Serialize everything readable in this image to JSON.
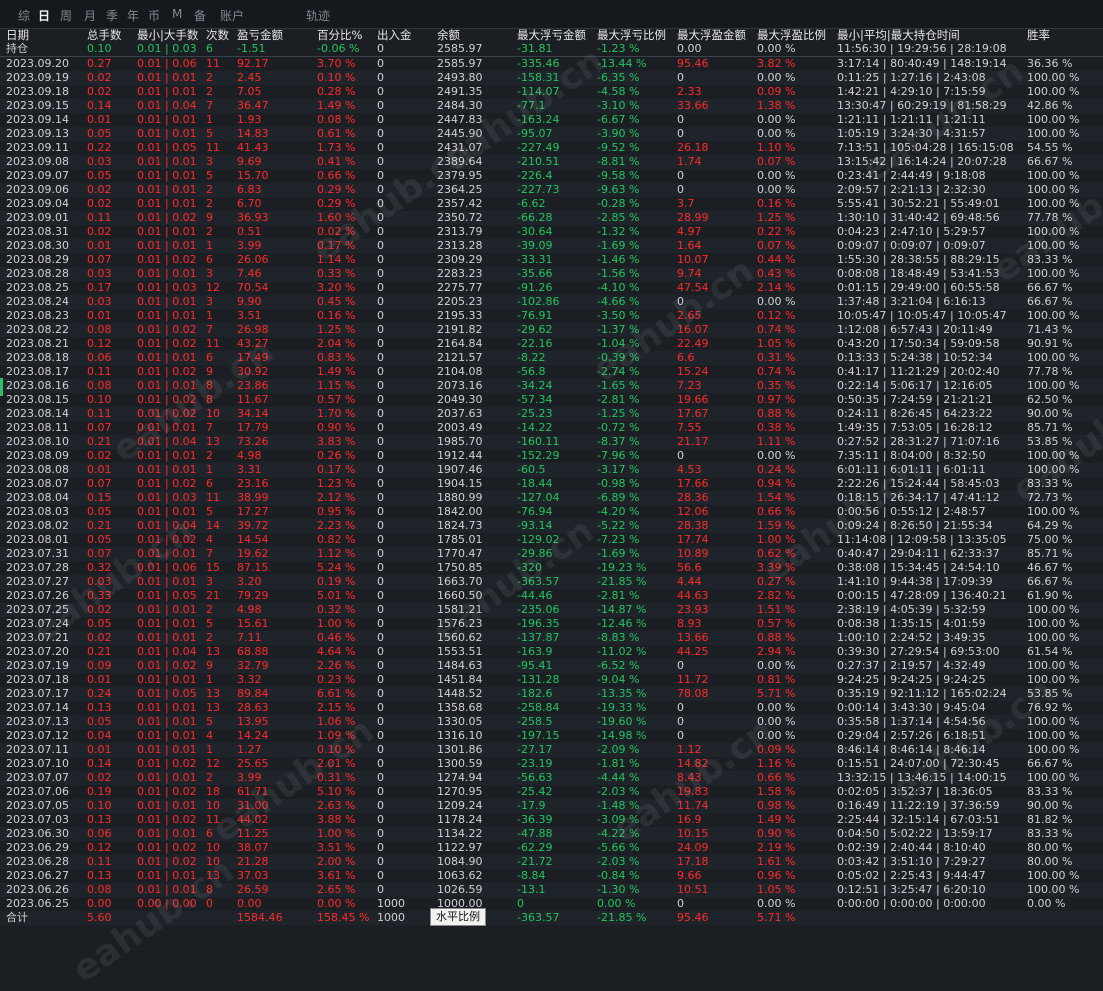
{
  "tabs": [
    {
      "label": "综",
      "active": false
    },
    {
      "label": "日",
      "active": true
    },
    {
      "label": "周",
      "active": false
    },
    {
      "label": "月",
      "active": false
    },
    {
      "label": "季",
      "active": false
    },
    {
      "label": "年",
      "active": false
    },
    {
      "label": "币",
      "active": false
    },
    {
      "label": "M",
      "active": false
    },
    {
      "label": "备",
      "active": false
    },
    {
      "label": "账户",
      "active": false
    },
    {
      "label": "轨迹",
      "active": false
    }
  ],
  "columns": [
    "日期\n持仓",
    "总手数",
    "最小|大手数",
    "次数",
    "盈亏金额",
    "百分比%",
    "出入金",
    "余额",
    "最大浮亏金额",
    "最大浮亏比例",
    "最大浮盈金额",
    "最大浮盈比例",
    "最小|平均|最大持仓时间",
    "胜率"
  ],
  "header_top": [
    "日期",
    "总手数",
    "最小|大手数",
    "次数",
    "盈亏金额",
    "百分比%",
    "出入金",
    "余额",
    "最大浮亏金额",
    "最大浮亏比例",
    "最大浮盈金额",
    "最大浮盈比例",
    "最小|平均|最大持仓时间",
    "胜率"
  ],
  "position_row": [
    "持仓",
    "0.10",
    "0.01 | 0.03",
    "6",
    "-1.51",
    "-0.06 %",
    "0",
    "2585.97",
    "-31.81",
    "-1.23 %",
    "0.00",
    "0.00 %",
    "11:56:30 | 19:29:56 | 28:19:08",
    ""
  ],
  "rows": [
    [
      "2023.09.20",
      "0.27",
      "0.01 | 0.06",
      "11",
      "92.17",
      "3.70 %",
      "0",
      "2585.97",
      "-335.46",
      "-13.44 %",
      "95.46",
      "3.82 %",
      "3:17:14 | 80:40:49 | 148:19:14",
      "36.36 %"
    ],
    [
      "2023.09.19",
      "0.02",
      "0.01 | 0.01",
      "2",
      "2.45",
      "0.10 %",
      "0",
      "2493.80",
      "-158.31",
      "-6.35 %",
      "0",
      "0.00 %",
      "0:11:25 | 1:27:16 | 2:43:08",
      "100.00 %"
    ],
    [
      "2023.09.18",
      "0.02",
      "0.01 | 0.01",
      "2",
      "7.05",
      "0.28 %",
      "0",
      "2491.35",
      "-114.07",
      "-4.58 %",
      "2.33",
      "0.09 %",
      "1:42:21 | 4:29:10 | 7:15:59",
      "100.00 %"
    ],
    [
      "2023.09.15",
      "0.14",
      "0.01 | 0.04",
      "7",
      "36.47",
      "1.49 %",
      "0",
      "2484.30",
      "-77.1",
      "-3.10 %",
      "33.66",
      "1.38 %",
      "13:30:47 | 60:29:19 | 81:58:29",
      "42.86 %"
    ],
    [
      "2023.09.14",
      "0.01",
      "0.01 | 0.01",
      "1",
      "1.93",
      "0.08 %",
      "0",
      "2447.83",
      "-163.24",
      "-6.67 %",
      "0",
      "0.00 %",
      "1:21:11 | 1:21:11 | 1:21:11",
      "100.00 %"
    ],
    [
      "2023.09.13",
      "0.05",
      "0.01 | 0.01",
      "5",
      "14.83",
      "0.61 %",
      "0",
      "2445.90",
      "-95.07",
      "-3.90 %",
      "0",
      "0.00 %",
      "1:05:19 | 3:24:30 | 4:31:57",
      "100.00 %"
    ],
    [
      "2023.09.11",
      "0.22",
      "0.01 | 0.05",
      "11",
      "41.43",
      "1.73 %",
      "0",
      "2431.07",
      "-227.49",
      "-9.52 %",
      "26.18",
      "1.10 %",
      "7:13:51 | 105:04:28 | 165:15:08",
      "54.55 %"
    ],
    [
      "2023.09.08",
      "0.03",
      "0.01 | 0.01",
      "3",
      "9.69",
      "0.41 %",
      "0",
      "2389.64",
      "-210.51",
      "-8.81 %",
      "1.74",
      "0.07 %",
      "13:15:42 | 16:14:24 | 20:07:28",
      "66.67 %"
    ],
    [
      "2023.09.07",
      "0.05",
      "0.01 | 0.01",
      "5",
      "15.70",
      "0.66 %",
      "0",
      "2379.95",
      "-226.4",
      "-9.58 %",
      "0",
      "0.00 %",
      "0:23:41 | 2:44:49 | 9:18:08",
      "100.00 %"
    ],
    [
      "2023.09.06",
      "0.02",
      "0.01 | 0.01",
      "2",
      "6.83",
      "0.29 %",
      "0",
      "2364.25",
      "-227.73",
      "-9.63 %",
      "0",
      "0.00 %",
      "2:09:57 | 2:21:13 | 2:32:30",
      "100.00 %"
    ],
    [
      "2023.09.04",
      "0.02",
      "0.01 | 0.01",
      "2",
      "6.70",
      "0.29 %",
      "0",
      "2357.42",
      "-6.62",
      "-0.28 %",
      "3.7",
      "0.16 %",
      "5:55:41 | 30:52:21 | 55:49:01",
      "100.00 %"
    ],
    [
      "2023.09.01",
      "0.11",
      "0.01 | 0.02",
      "9",
      "36.93",
      "1.60 %",
      "0",
      "2350.72",
      "-66.28",
      "-2.85 %",
      "28.99",
      "1.25 %",
      "1:30:10 | 31:40:42 | 69:48:56",
      "77.78 %"
    ],
    [
      "2023.08.31",
      "0.02",
      "0.01 | 0.01",
      "2",
      "0.51",
      "0.02 %",
      "0",
      "2313.79",
      "-30.64",
      "-1.32 %",
      "4.97",
      "0.22 %",
      "0:04:23 | 2:47:10 | 5:29:57",
      "100.00 %"
    ],
    [
      "2023.08.30",
      "0.01",
      "0.01 | 0.01",
      "1",
      "3.99",
      "0.17 %",
      "0",
      "2313.28",
      "-39.09",
      "-1.69 %",
      "1.64",
      "0.07 %",
      "0:09:07 | 0:09:07 | 0:09:07",
      "100.00 %"
    ],
    [
      "2023.08.29",
      "0.07",
      "0.01 | 0.02",
      "6",
      "26.06",
      "1.14 %",
      "0",
      "2309.29",
      "-33.31",
      "-1.46 %",
      "10.07",
      "0.44 %",
      "1:55:30 | 28:38:55 | 88:29:15",
      "83.33 %"
    ],
    [
      "2023.08.28",
      "0.03",
      "0.01 | 0.01",
      "3",
      "7.46",
      "0.33 %",
      "0",
      "2283.23",
      "-35.66",
      "-1.56 %",
      "9.74",
      "0.43 %",
      "0:08:08 | 18:48:49 | 53:41:53",
      "100.00 %"
    ],
    [
      "2023.08.25",
      "0.17",
      "0.01 | 0.03",
      "12",
      "70.54",
      "3.20 %",
      "0",
      "2275.77",
      "-91.26",
      "-4.10 %",
      "47.54",
      "2.14 %",
      "0:01:15 | 29:49:00 | 60:55:58",
      "66.67 %"
    ],
    [
      "2023.08.24",
      "0.03",
      "0.01 | 0.01",
      "3",
      "9.90",
      "0.45 %",
      "0",
      "2205.23",
      "-102.86",
      "-4.66 %",
      "0",
      "0.00 %",
      "1:37:48 | 3:21:04 | 6:16:13",
      "66.67 %"
    ],
    [
      "2023.08.23",
      "0.01",
      "0.01 | 0.01",
      "1",
      "3.51",
      "0.16 %",
      "0",
      "2195.33",
      "-76.91",
      "-3.50 %",
      "2.65",
      "0.12 %",
      "10:05:47 | 10:05:47 | 10:05:47",
      "100.00 %"
    ],
    [
      "2023.08.22",
      "0.08",
      "0.01 | 0.02",
      "7",
      "26.98",
      "1.25 %",
      "0",
      "2191.82",
      "-29.62",
      "-1.37 %",
      "16.07",
      "0.74 %",
      "1:12:08 | 6:57:43 | 20:11:49",
      "71.43 %"
    ],
    [
      "2023.08.21",
      "0.12",
      "0.01 | 0.02",
      "11",
      "43.27",
      "2.04 %",
      "0",
      "2164.84",
      "-22.16",
      "-1.04 %",
      "22.49",
      "1.05 %",
      "0:43:20 | 17:50:34 | 59:09:58",
      "90.91 %"
    ],
    [
      "2023.08.18",
      "0.06",
      "0.01 | 0.01",
      "6",
      "17.49",
      "0.83 %",
      "0",
      "2121.57",
      "-8.22",
      "-0.39 %",
      "6.6",
      "0.31 %",
      "0:13:33 | 5:24:38 | 10:52:34",
      "100.00 %"
    ],
    [
      "2023.08.17",
      "0.11",
      "0.01 | 0.02",
      "9",
      "30.92",
      "1.49 %",
      "0",
      "2104.08",
      "-56.8",
      "-2.74 %",
      "15.24",
      "0.74 %",
      "0:41:17 | 11:21:29 | 20:02:40",
      "77.78 %"
    ],
    [
      "2023.08.16",
      "0.08",
      "0.01 | 0.01",
      "8",
      "23.86",
      "1.15 %",
      "0",
      "2073.16",
      "-34.24",
      "-1.65 %",
      "7.23",
      "0.35 %",
      "0:22:14 | 5:06:17 | 12:16:05",
      "100.00 %"
    ],
    [
      "2023.08.15",
      "0.10",
      "0.01 | 0.02",
      "8",
      "11.67",
      "0.57 %",
      "0",
      "2049.30",
      "-57.34",
      "-2.81 %",
      "19.66",
      "0.97 %",
      "0:50:35 | 7:24:59 | 21:21:21",
      "62.50 %"
    ],
    [
      "2023.08.14",
      "0.11",
      "0.01 | 0.02",
      "10",
      "34.14",
      "1.70 %",
      "0",
      "2037.63",
      "-25.23",
      "-1.25 %",
      "17.67",
      "0.88 %",
      "0:24:11 | 8:26:45 | 64:23:22",
      "90.00 %"
    ],
    [
      "2023.08.11",
      "0.07",
      "0.01 | 0.01",
      "7",
      "17.79",
      "0.90 %",
      "0",
      "2003.49",
      "-14.22",
      "-0.72 %",
      "7.55",
      "0.38 %",
      "1:49:35 | 7:53:05 | 16:28:12",
      "85.71 %"
    ],
    [
      "2023.08.10",
      "0.21",
      "0.01 | 0.04",
      "13",
      "73.26",
      "3.83 %",
      "0",
      "1985.70",
      "-160.11",
      "-8.37 %",
      "21.17",
      "1.11 %",
      "0:27:52 | 28:31:27 | 71:07:16",
      "53.85 %"
    ],
    [
      "2023.08.09",
      "0.02",
      "0.01 | 0.01",
      "2",
      "4.98",
      "0.26 %",
      "0",
      "1912.44",
      "-152.29",
      "-7.96 %",
      "0",
      "0.00 %",
      "7:35:11 | 8:04:00 | 8:32:50",
      "100.00 %"
    ],
    [
      "2023.08.08",
      "0.01",
      "0.01 | 0.01",
      "1",
      "3.31",
      "0.17 %",
      "0",
      "1907.46",
      "-60.5",
      "-3.17 %",
      "4.53",
      "0.24 %",
      "6:01:11 | 6:01:11 | 6:01:11",
      "100.00 %"
    ],
    [
      "2023.08.07",
      "0.07",
      "0.01 | 0.02",
      "6",
      "23.16",
      "1.23 %",
      "0",
      "1904.15",
      "-18.44",
      "-0.98 %",
      "17.66",
      "0.94 %",
      "2:22:26 | 15:24:44 | 58:45:03",
      "83.33 %"
    ],
    [
      "2023.08.04",
      "0.15",
      "0.01 | 0.03",
      "11",
      "38.99",
      "2.12 %",
      "0",
      "1880.99",
      "-127.04",
      "-6.89 %",
      "28.36",
      "1.54 %",
      "0:18:15 | 26:34:17 | 47:41:12",
      "72.73 %"
    ],
    [
      "2023.08.03",
      "0.05",
      "0.01 | 0.01",
      "5",
      "17.27",
      "0.95 %",
      "0",
      "1842.00",
      "-76.94",
      "-4.20 %",
      "12.06",
      "0.66 %",
      "0:00:56 | 0:55:12 | 2:48:57",
      "100.00 %"
    ],
    [
      "2023.08.02",
      "0.21",
      "0.01 | 0.04",
      "14",
      "39.72",
      "2.23 %",
      "0",
      "1824.73",
      "-93.14",
      "-5.22 %",
      "28.38",
      "1.59 %",
      "0:09:24 | 8:26:50 | 21:55:34",
      "64.29 %"
    ],
    [
      "2023.08.01",
      "0.05",
      "0.01 | 0.02",
      "4",
      "14.54",
      "0.82 %",
      "0",
      "1785.01",
      "-129.02",
      "-7.23 %",
      "17.74",
      "1.00 %",
      "11:14:08 | 12:09:58 | 13:35:05",
      "75.00 %"
    ],
    [
      "2023.07.31",
      "0.07",
      "0.01 | 0.01",
      "7",
      "19.62",
      "1.12 %",
      "0",
      "1770.47",
      "-29.86",
      "-1.69 %",
      "10.89",
      "0.62 %",
      "0:40:47 | 29:04:11 | 62:33:37",
      "85.71 %"
    ],
    [
      "2023.07.28",
      "0.32",
      "0.01 | 0.06",
      "15",
      "87.15",
      "5.24 %",
      "0",
      "1750.85",
      "-320",
      "-19.23 %",
      "56.6",
      "3.39 %",
      "0:38:08 | 15:34:45 | 24:54:10",
      "46.67 %"
    ],
    [
      "2023.07.27",
      "0.03",
      "0.01 | 0.01",
      "3",
      "3.20",
      "0.19 %",
      "0",
      "1663.70",
      "-363.57",
      "-21.85 %",
      "4.44",
      "0.27 %",
      "1:41:10 | 9:44:38 | 17:09:39",
      "66.67 %"
    ],
    [
      "2023.07.26",
      "0.33",
      "0.01 | 0.05",
      "21",
      "79.29",
      "5.01 %",
      "0",
      "1660.50",
      "-44.46",
      "-2.81 %",
      "44.63",
      "2.82 %",
      "0:00:15 | 47:28:09 | 136:40:21",
      "61.90 %"
    ],
    [
      "2023.07.25",
      "0.02",
      "0.01 | 0.01",
      "2",
      "4.98",
      "0.32 %",
      "0",
      "1581.21",
      "-235.06",
      "-14.87 %",
      "23.93",
      "1.51 %",
      "2:38:19 | 4:05:39 | 5:32:59",
      "100.00 %"
    ],
    [
      "2023.07.24",
      "0.05",
      "0.01 | 0.01",
      "5",
      "15.61",
      "1.00 %",
      "0",
      "1576.23",
      "-196.35",
      "-12.46 %",
      "8.93",
      "0.57 %",
      "0:08:38 | 1:35:15 | 4:01:59",
      "100.00 %"
    ],
    [
      "2023.07.21",
      "0.02",
      "0.01 | 0.01",
      "2",
      "7.11",
      "0.46 %",
      "0",
      "1560.62",
      "-137.87",
      "-8.83 %",
      "13.66",
      "0.88 %",
      "1:00:10 | 2:24:52 | 3:49:35",
      "100.00 %"
    ],
    [
      "2023.07.20",
      "0.21",
      "0.01 | 0.04",
      "13",
      "68.88",
      "4.64 %",
      "0",
      "1553.51",
      "-163.9",
      "-11.02 %",
      "44.25",
      "2.94 %",
      "0:39:30 | 27:29:54 | 69:53:00",
      "61.54 %"
    ],
    [
      "2023.07.19",
      "0.09",
      "0.01 | 0.02",
      "9",
      "32.79",
      "2.26 %",
      "0",
      "1484.63",
      "-95.41",
      "-6.52 %",
      "0",
      "0.00 %",
      "0:27:37 | 2:19:57 | 4:32:49",
      "100.00 %"
    ],
    [
      "2023.07.18",
      "0.01",
      "0.01 | 0.01",
      "1",
      "3.32",
      "0.23 %",
      "0",
      "1451.84",
      "-131.28",
      "-9.04 %",
      "11.72",
      "0.81 %",
      "9:24:25 | 9:24:25 | 9:24:25",
      "100.00 %"
    ],
    [
      "2023.07.17",
      "0.24",
      "0.01 | 0.05",
      "13",
      "89.84",
      "6.61 %",
      "0",
      "1448.52",
      "-182.6",
      "-13.35 %",
      "78.08",
      "5.71 %",
      "0:35:19 | 92:11:12 | 165:02:24",
      "53.85 %"
    ],
    [
      "2023.07.14",
      "0.13",
      "0.01 | 0.01",
      "13",
      "28.63",
      "2.15 %",
      "0",
      "1358.68",
      "-258.84",
      "-19.33 %",
      "0",
      "0.00 %",
      "0:00:14 | 3:43:30 | 9:45:04",
      "76.92 %"
    ],
    [
      "2023.07.13",
      "0.05",
      "0.01 | 0.01",
      "5",
      "13.95",
      "1.06 %",
      "0",
      "1330.05",
      "-258.5",
      "-19.60 %",
      "0",
      "0.00 %",
      "0:35:58 | 1:37:14 | 4:54:56",
      "100.00 %"
    ],
    [
      "2023.07.12",
      "0.04",
      "0.01 | 0.01",
      "4",
      "14.24",
      "1.09 %",
      "0",
      "1316.10",
      "-197.15",
      "-14.98 %",
      "0",
      "0.00 %",
      "0:29:04 | 2:57:26 | 6:18:51",
      "100.00 %"
    ],
    [
      "2023.07.11",
      "0.01",
      "0.01 | 0.01",
      "1",
      "1.27",
      "0.10 %",
      "0",
      "1301.86",
      "-27.17",
      "-2.09 %",
      "1.12",
      "0.09 %",
      "8:46:14 | 8:46:14 | 8:46:14",
      "100.00 %"
    ],
    [
      "2023.07.10",
      "0.14",
      "0.01 | 0.02",
      "12",
      "25.65",
      "2.01 %",
      "0",
      "1300.59",
      "-23.19",
      "-1.81 %",
      "14.82",
      "1.16 %",
      "0:15:51 | 24:07:00 | 72:30:45",
      "66.67 %"
    ],
    [
      "2023.07.07",
      "0.02",
      "0.01 | 0.01",
      "2",
      "3.99",
      "0.31 %",
      "0",
      "1274.94",
      "-56.63",
      "-4.44 %",
      "8.43",
      "0.66 %",
      "13:32:15 | 13:46:15 | 14:00:15",
      "100.00 %"
    ],
    [
      "2023.07.06",
      "0.19",
      "0.01 | 0.02",
      "18",
      "61.71",
      "5.10 %",
      "0",
      "1270.95",
      "-25.42",
      "-2.03 %",
      "19.83",
      "1.58 %",
      "0:02:05 | 3:52:37 | 18:36:05",
      "83.33 %"
    ],
    [
      "2023.07.05",
      "0.10",
      "0.01 | 0.01",
      "10",
      "31.00",
      "2.63 %",
      "0",
      "1209.24",
      "-17.9",
      "-1.48 %",
      "11.74",
      "0.98 %",
      "0:16:49 | 11:22:19 | 37:36:59",
      "90.00 %"
    ],
    [
      "2023.07.03",
      "0.13",
      "0.01 | 0.02",
      "11",
      "44.02",
      "3.88 %",
      "0",
      "1178.24",
      "-36.39",
      "-3.09 %",
      "16.9",
      "1.49 %",
      "2:25:44 | 32:15:14 | 67:03:51",
      "81.82 %"
    ],
    [
      "2023.06.30",
      "0.06",
      "0.01 | 0.01",
      "6",
      "11.25",
      "1.00 %",
      "0",
      "1134.22",
      "-47.88",
      "-4.22 %",
      "10.15",
      "0.90 %",
      "0:04:50 | 5:02:22 | 13:59:17",
      "83.33 %"
    ],
    [
      "2023.06.29",
      "0.12",
      "0.01 | 0.02",
      "10",
      "38.07",
      "3.51 %",
      "0",
      "1122.97",
      "-62.29",
      "-5.66 %",
      "24.09",
      "2.19 %",
      "0:02:39 | 2:40:44 | 8:10:40",
      "80.00 %"
    ],
    [
      "2023.06.28",
      "0.11",
      "0.01 | 0.02",
      "10",
      "21.28",
      "2.00 %",
      "0",
      "1084.90",
      "-21.72",
      "-2.03 %",
      "17.18",
      "1.61 %",
      "0:03:42 | 3:51:10 | 7:29:27",
      "80.00 %"
    ],
    [
      "2023.06.27",
      "0.13",
      "0.01 | 0.01",
      "13",
      "37.03",
      "3.61 %",
      "0",
      "1063.62",
      "-8.84",
      "-0.84 %",
      "9.66",
      "0.96 %",
      "0:05:02 | 2:25:43 | 9:44:47",
      "100.00 %"
    ],
    [
      "2023.06.26",
      "0.08",
      "0.01 | 0.01",
      "8",
      "26.59",
      "2.65 %",
      "0",
      "1026.59",
      "-13.1",
      "-1.30 %",
      "10.51",
      "1.05 %",
      "0:12:51 | 3:25:47 | 6:20:10",
      "100.00 %"
    ],
    [
      "2023.06.25",
      "0.00",
      "0.00 | 0.00",
      "0",
      "0.00",
      "0.00 %",
      "1000",
      "1000.00",
      "0",
      "0.00 %",
      "0",
      "0.00 %",
      "0:00:00 | 0:00:00 | 0:00:00",
      "0.00 %"
    ]
  ],
  "total_row": [
    "合计",
    "5.60",
    "",
    "",
    "1584.46",
    "158.45 %",
    "1000",
    "",
    "-363.57",
    "-21.85 %",
    "95.46",
    "5.71 %",
    "",
    ""
  ],
  "tooltip": "水平比例",
  "watermark": "eahub.cn",
  "colors": {
    "profit": "#ff2a2a",
    "loss": "#22c55e",
    "neutral": "#d0d0d0",
    "background": "#1b1f24"
  }
}
